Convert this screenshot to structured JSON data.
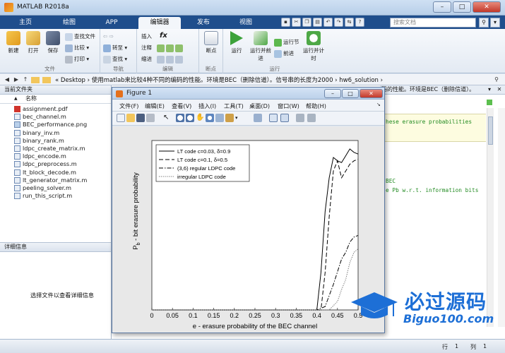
{
  "window": {
    "title": "MATLAB R2018a",
    "min": "–",
    "max": "□",
    "close": "✕"
  },
  "tabs": [
    {
      "label": "主页"
    },
    {
      "label": "绘图"
    },
    {
      "label": "APP"
    },
    {
      "label": "编辑器"
    },
    {
      "label": "发布"
    },
    {
      "label": "视图"
    }
  ],
  "search": {
    "placeholder": "搜索文档"
  },
  "ribbon": {
    "file": {
      "new": "新建",
      "open": "打开",
      "save": "保存",
      "find_files": "查找文件",
      "compare": "比较",
      "print": "打印",
      "group": "文件"
    },
    "nav": {
      "goto": "转至",
      "find": "查找",
      "group": "导航"
    },
    "edit": {
      "insert": "插入",
      "comment": "注释",
      "indent": "缩进",
      "fx": "fx",
      "group": "编辑"
    },
    "breakpoints": {
      "label": "断点",
      "group": "断点"
    },
    "run": {
      "run": "运行",
      "run_advance": "运行并前进",
      "run_section": "运行节",
      "advance": "前进",
      "run_time": "运行并计时",
      "group": "运行"
    }
  },
  "address": {
    "path": "« Desktop › 使用matlab来比较4种不同的编码的性能。环境是BEC（删除信道）。信号串的长度为2000 › hw6_solution ›"
  },
  "current_folder": {
    "title": "当前文件夹",
    "col_name": "名称",
    "sort_arrow": "▲",
    "files": [
      {
        "name": "assignment.pdf",
        "type": "pdf"
      },
      {
        "name": "bec_channel.m",
        "type": "m"
      },
      {
        "name": "BEC_performance.png",
        "type": "png"
      },
      {
        "name": "binary_inv.m",
        "type": "m"
      },
      {
        "name": "binary_rank.m",
        "type": "m"
      },
      {
        "name": "ldpc_create_matrix.m",
        "type": "m"
      },
      {
        "name": "ldpc_encode.m",
        "type": "m"
      },
      {
        "name": "ldpc_preprocess.m",
        "type": "m"
      },
      {
        "name": "lt_block_decode.m",
        "type": "m"
      },
      {
        "name": "lt_generator_matrix.m",
        "type": "m"
      },
      {
        "name": "peeling_solver.m",
        "type": "m"
      },
      {
        "name": "run_this_script.m",
        "type": "m"
      }
    ]
  },
  "details": {
    "title": "详细信息",
    "hint": "选择文件以查看详细信息"
  },
  "editor": {
    "header_text": "码的性能。环境是BEC（删除信道）。",
    "code_lines": [
      {
        "text": "hese erasure probabilities"
      },
      {
        "text": "BEC"
      },
      {
        "text": "e Pb w.r.t. information bits"
      }
    ]
  },
  "figure": {
    "title": "Figure 1",
    "menu": [
      "文件(F)",
      "编辑(E)",
      "查看(V)",
      "插入(I)",
      "工具(T)",
      "桌面(D)",
      "窗口(W)",
      "帮助(H)"
    ]
  },
  "chart_data": {
    "type": "line",
    "xlabel": "e - erasure probability of the BEC channel",
    "ylabel": "P_b - bit erasure probability",
    "xlim": [
      0,
      0.5
    ],
    "ylim": [
      0,
      1
    ],
    "xticks": [
      "0",
      "0.05",
      "0.1",
      "0.15",
      "0.2",
      "0.25",
      "0.3",
      "0.35",
      "0.4",
      "0.45",
      "0.5"
    ],
    "yticks": [],
    "grid": false,
    "legend_position": "top-left",
    "series": [
      {
        "name": "LT code c=0.03, δ=0.9",
        "style": "solid",
        "x": [
          0,
          0.4,
          0.41,
          0.42,
          0.43,
          0.44,
          0.45,
          0.46,
          0.47,
          0.48,
          0.49,
          0.5
        ],
        "y": [
          0,
          0,
          0.22,
          0.58,
          0.78,
          0.9,
          0.88,
          0.87,
          0.91,
          0.95,
          0.93,
          0.92
        ]
      },
      {
        "name": "LT code c=0.1, δ=0.5",
        "style": "dashed",
        "x": [
          0,
          0.41,
          0.42,
          0.43,
          0.44,
          0.45,
          0.46,
          0.47,
          0.48,
          0.49,
          0.5
        ],
        "y": [
          0,
          0,
          0.22,
          0.55,
          0.82,
          0.88,
          0.78,
          0.82,
          0.86,
          0.88,
          0.89
        ]
      },
      {
        "name": "(3,6) regular LDPC code",
        "style": "dashdot",
        "x": [
          0,
          0.4,
          0.42,
          0.44,
          0.46,
          0.47,
          0.48,
          0.49,
          0.5
        ],
        "y": [
          0,
          0,
          0.02,
          0.15,
          0.3,
          0.34,
          0.4,
          0.43,
          0.44
        ]
      },
      {
        "name": "irregular LDPC code",
        "style": "dotted",
        "x": [
          0,
          0.43,
          0.45,
          0.46,
          0.47,
          0.48,
          0.49,
          0.5
        ],
        "y": [
          0,
          0,
          0.05,
          0.12,
          0.18,
          0.28,
          0.34,
          0.36
        ]
      }
    ]
  },
  "watermark": {
    "big": "必过源码",
    "small": "Biguo100.com"
  },
  "status": {
    "row_label": "行",
    "row": "1",
    "col_label": "列",
    "col": "1"
  }
}
